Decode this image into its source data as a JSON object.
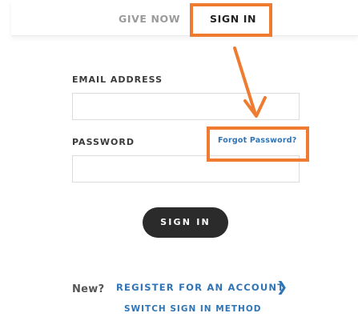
{
  "nav": {
    "give_label": "GIVE NOW",
    "signin_label": "SIGN IN"
  },
  "form": {
    "email_label": "EMAIL ADDRESS",
    "email_value": "",
    "password_label": "PASSWORD",
    "password_value": "",
    "forgot_label": "Forgot Password?",
    "signin_button": "SIGN IN"
  },
  "footer": {
    "new_text": "New?",
    "register_label": "REGISTER FOR AN ACCOUNT",
    "chevron_icon": "chevron-right-icon",
    "switch_label": "SWITCH SIGN IN METHOD"
  },
  "colors": {
    "annotation": "#ee7b30",
    "link": "#2f74b5",
    "button": "#2b2b2b"
  }
}
